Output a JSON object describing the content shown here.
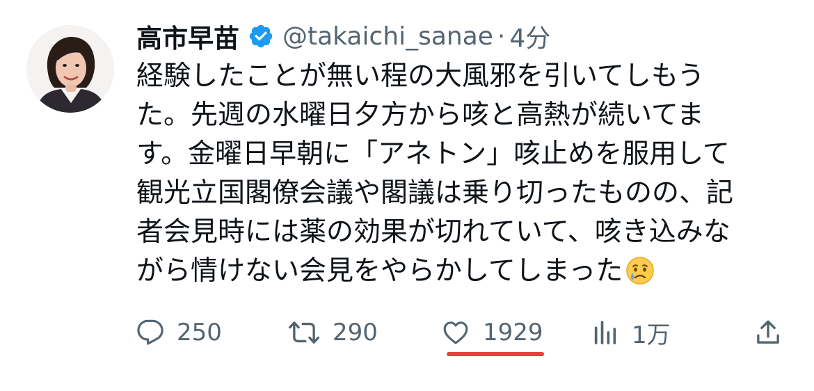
{
  "author": {
    "display_name": "高市早苗",
    "handle": "@takaichi_sanae",
    "separator": "·",
    "time": "4分",
    "verified": true,
    "verified_color": "#1d9bf0"
  },
  "tweet": {
    "lines": [
      "経験したことが無い程の大風邪を引いてしもう",
      "た。先週の水曜日夕方から咳と高熱が続いてま",
      "す。金曜日早朝に「アネトン」咳止めを服用して",
      "観光立国閣僚会議や閣議は乗り切ったものの、記",
      "者会見時には薬の効果が切れていて、咳き込みな",
      "がら情けない会見をやらかしてしまった"
    ],
    "trailing_emoji": "crying-face-emoji"
  },
  "actions": {
    "reply": {
      "icon": "reply-icon",
      "count": "250"
    },
    "retweet": {
      "icon": "retweet-icon",
      "count": "290"
    },
    "like": {
      "icon": "heart-icon",
      "count": "1929",
      "highlight_color": "#e8403a"
    },
    "views": {
      "icon": "views-chart-icon",
      "count": "1万"
    },
    "share": {
      "icon": "share-icon"
    }
  },
  "colors": {
    "text_primary": "#0f1419",
    "text_secondary": "#536471"
  }
}
